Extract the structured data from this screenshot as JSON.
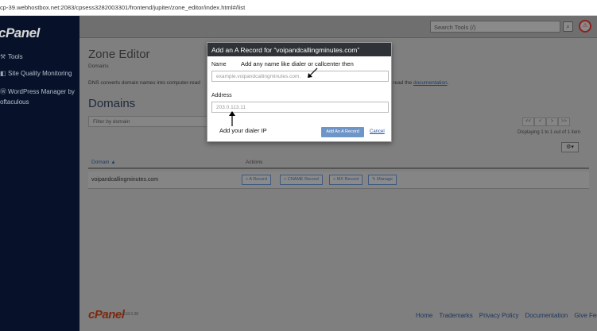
{
  "browser": {
    "url": "cp-39.webhostbox.net:2083/cpsess3282003301/frontend/jupiter/zone_editor/index.html#/list"
  },
  "sidebar": {
    "logo": "cPanel",
    "items": [
      {
        "label": "Tools",
        "icon": "wrench-icon"
      },
      {
        "label": "Site Quality Monitoring",
        "icon": "monitor-icon"
      },
      {
        "label": "WordPress Manager by",
        "icon": "wordpress-icon"
      },
      {
        "label": "oftaculous",
        "icon": ""
      }
    ]
  },
  "topbar": {
    "search_placeholder": "Search Tools (/)",
    "search_icon": "search-icon",
    "notification_icon": "bell-icon"
  },
  "page": {
    "title": "Zone Editor",
    "breadcrumb": "Domains",
    "description": "DNS converts domain names into computer-read",
    "description_tail": "ion, read the",
    "doc_link": "documentation",
    "doc_link_suffix": ".",
    "domains_title": "Domains",
    "filter_placeholder": "Filter by domain",
    "pager": [
      "<<",
      "<",
      ">",
      ">>"
    ],
    "displaying": "Displaying 1 to 1 out of 1 item",
    "settings_icon": "gear-icon",
    "settings_caret": "▾"
  },
  "table": {
    "col_domain": "Domain",
    "col_domain_sort": "▲",
    "col_actions": "Actions",
    "rows": [
      {
        "domain": "voipandcallingminutes.com",
        "actions": [
          "+ A Record",
          "+ CNAME Record",
          "+ MX Record",
          "Manage"
        ]
      }
    ]
  },
  "footer": {
    "logo": "cPanel",
    "version": "118.0.38",
    "links": [
      "Home",
      "Trademarks",
      "Privacy Policy",
      "Documentation",
      "Give Feedb"
    ]
  },
  "modal": {
    "title": "Add an A Record for “voipandcallingminutes.com”",
    "name_label": "Name",
    "name_placeholder": "example.voipandcallingminutes.com.",
    "address_label": "Address",
    "address_placeholder": "203.0.113.11",
    "submit_label": "Add An A Record",
    "cancel_label": "Cancel"
  },
  "annotations": {
    "name_hint": "Add any name like dialer or callcenter then",
    "address_hint": "Add your dialer IP"
  }
}
